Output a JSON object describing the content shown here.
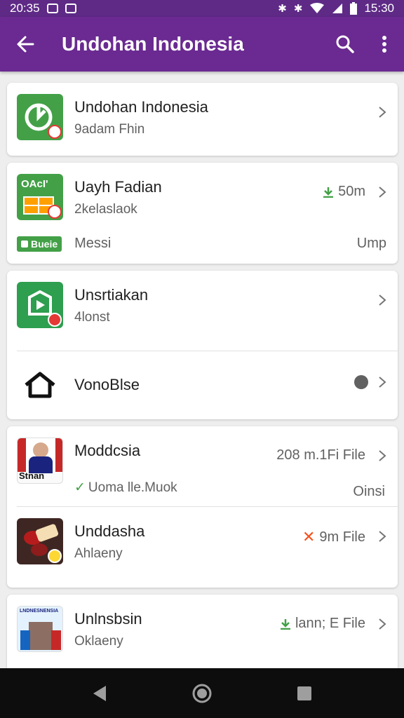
{
  "status": {
    "time_left": "20:35",
    "time_right": "15:30",
    "bluetooth_icons": [
      "✱",
      "✱"
    ]
  },
  "appbar": {
    "title": "Undohan Indonesia"
  },
  "cards": [
    {
      "rows": [
        {
          "title": "Undohan Indonesia",
          "subtitle": "9adam Fhin",
          "meta": "",
          "icon": "phone-app-icon"
        }
      ]
    },
    {
      "rows": [
        {
          "title": "Uayh Fadian",
          "subtitle": "2kelaslaok",
          "meta": "50m",
          "icon": "calendar-app-icon",
          "thumb_text": "OAcI'"
        }
      ],
      "footer": {
        "tag": "Bueie",
        "left": "Messi",
        "right": "Ump"
      }
    },
    {
      "rows": [
        {
          "title": "Unsrtiakan",
          "subtitle": "4lonst",
          "meta": "",
          "icon": "play-app-icon"
        },
        {
          "title": "VonoBlse",
          "subtitle": "",
          "meta": "",
          "icon": "home-icon"
        }
      ]
    },
    {
      "rows": [
        {
          "title": "Moddcsia",
          "subtitle": "Uoma lle.Muok",
          "meta": "208 m.1Fi File",
          "icon": "news-thumbnail",
          "thumb_text": "Stnan",
          "sub_right": "Oinsi"
        },
        {
          "title": "Unddasha",
          "subtitle": "Ahlaeny",
          "meta": "9m File",
          "icon": "food-thumbnail"
        }
      ]
    },
    {
      "rows": [
        {
          "title": "Unlnsbsin",
          "subtitle": "Oklaeny",
          "meta": "lann; E File",
          "icon": "building-thumbnail",
          "thumb_text": "LNDNESNENSIA"
        }
      ]
    }
  ],
  "colors": {
    "statusbar": "#5e2a86",
    "appbar": "#6a2a91",
    "accent_green": "#43a047",
    "accent_orange": "#f4511e",
    "navbar": "#0d0d0d"
  }
}
